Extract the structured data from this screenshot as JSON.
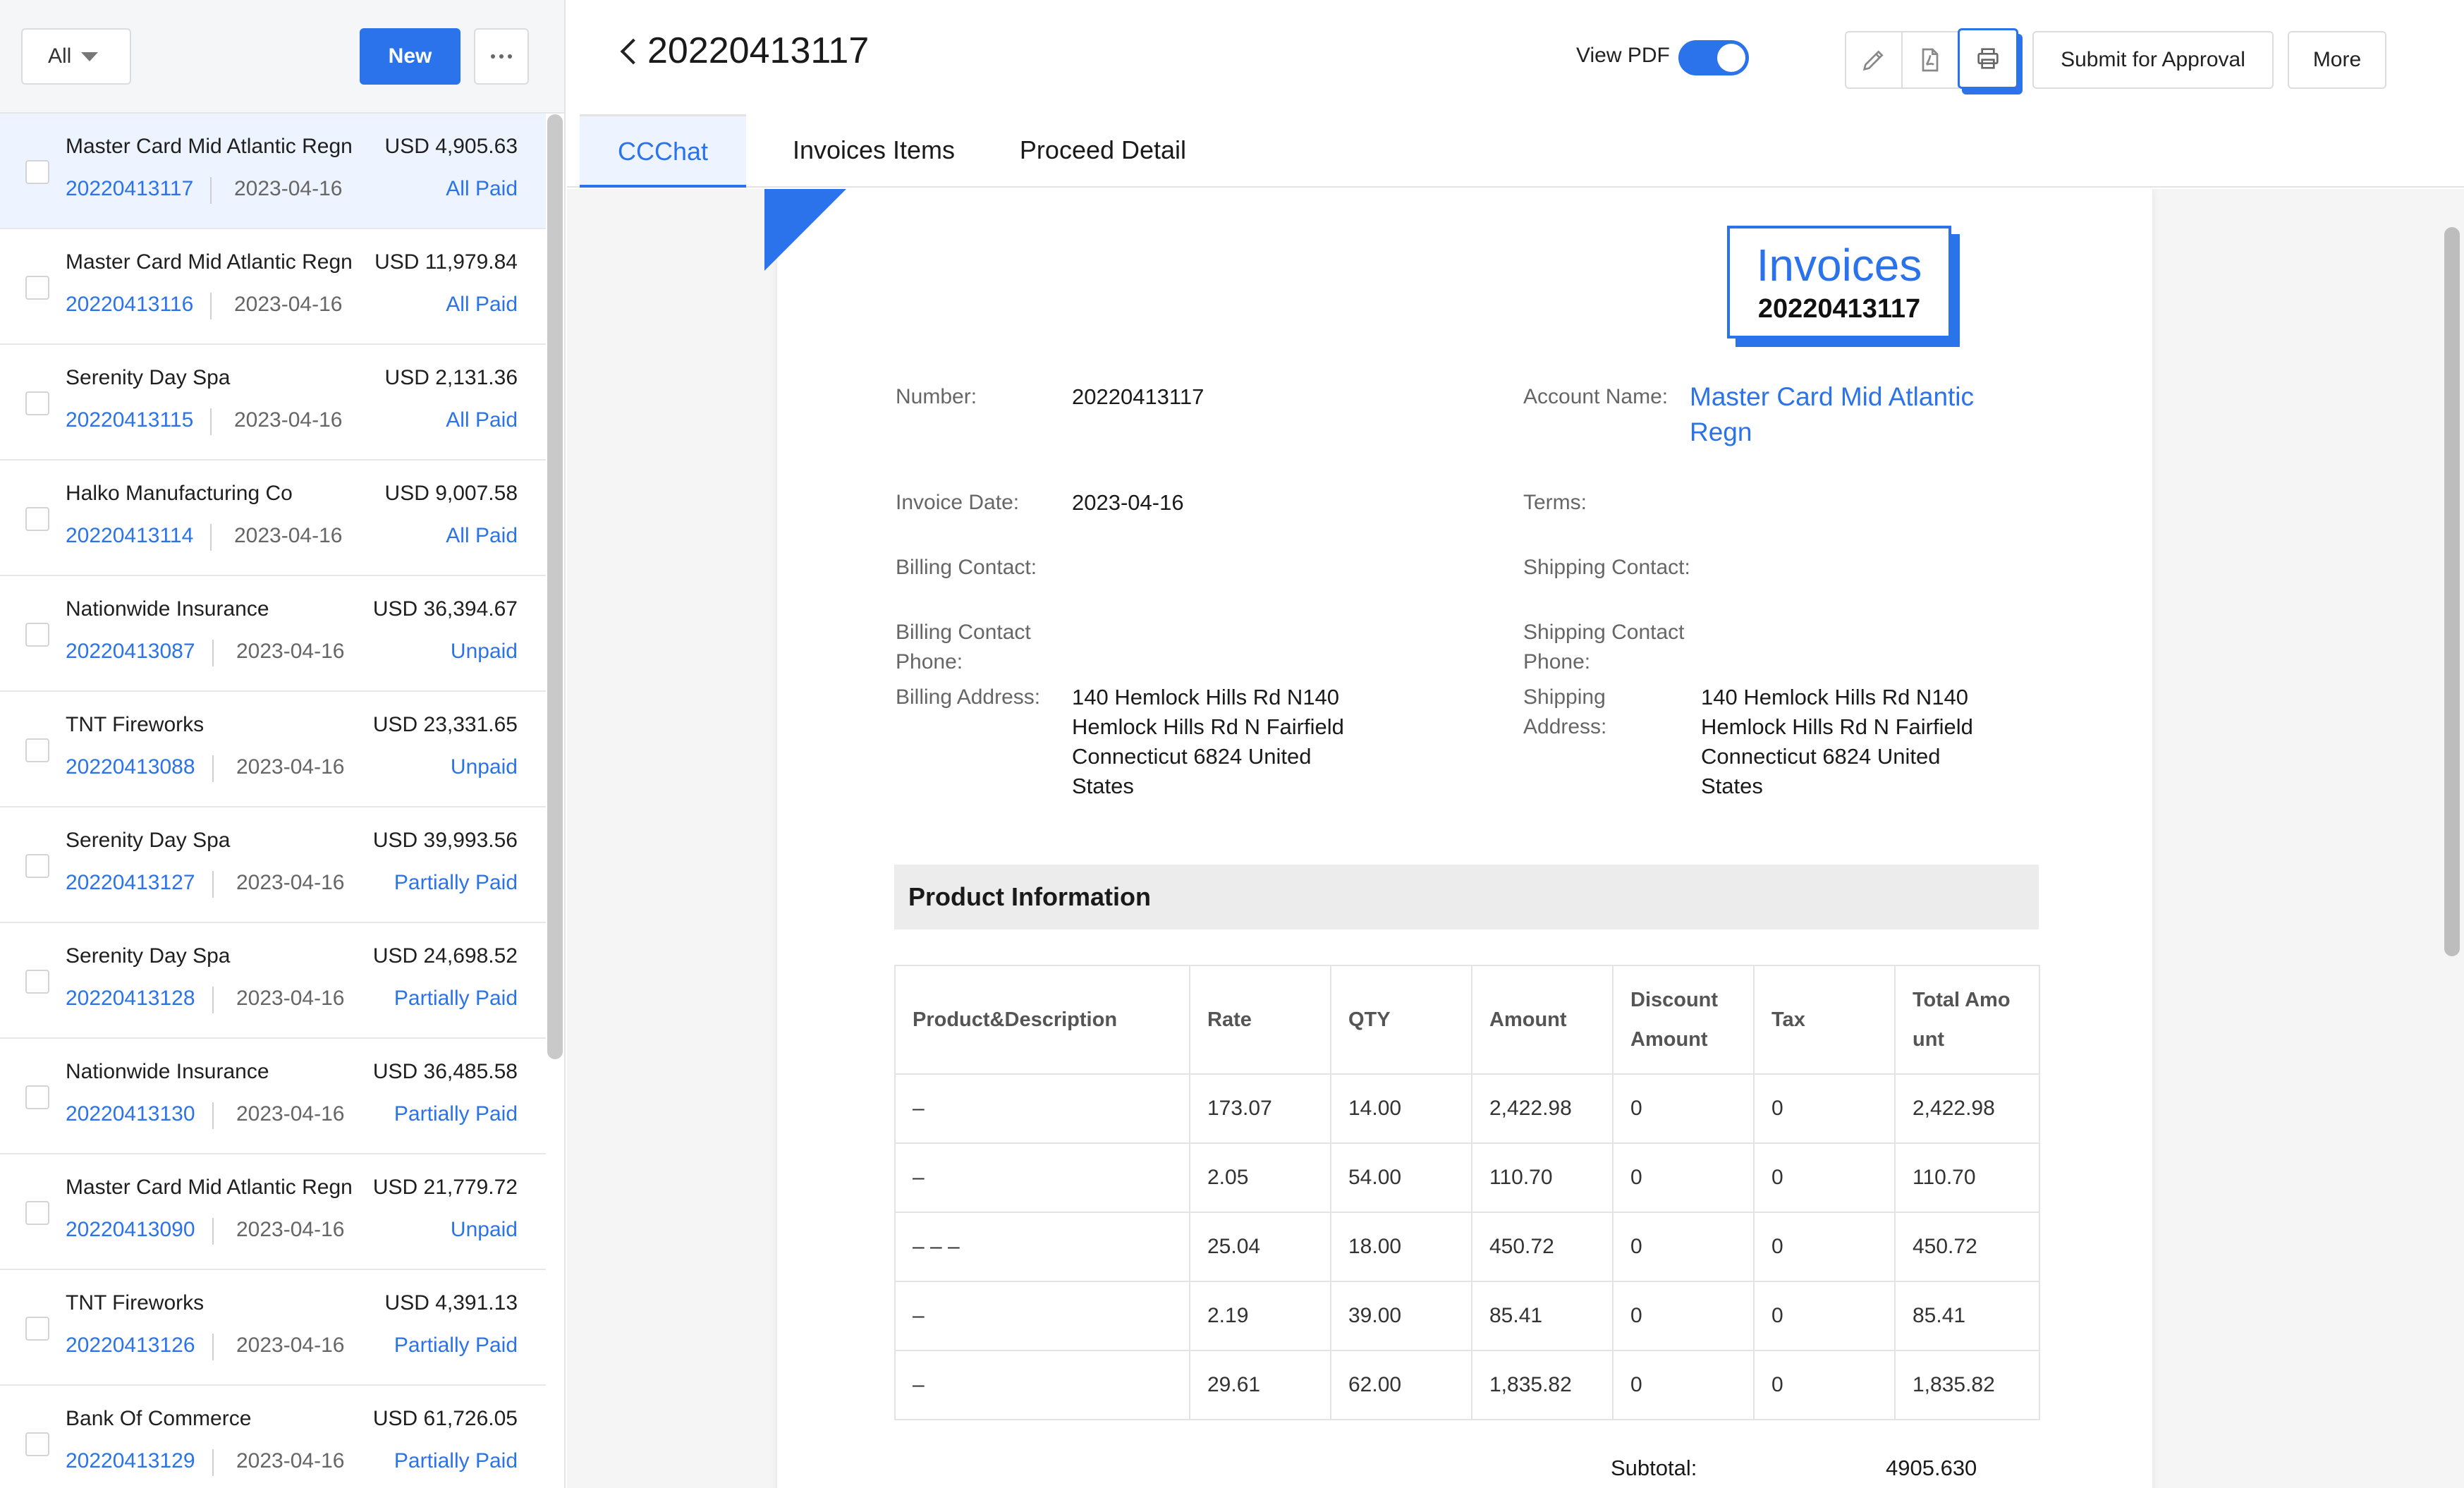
{
  "list_toolbar": {
    "filter_label": "All",
    "new_label": "New"
  },
  "invoices": [
    {
      "name": "Master Card Mid Atlantic Regn",
      "amount": "USD 4,905.63",
      "number": "20220413117",
      "date": "2023-04-16",
      "status": "All Paid"
    },
    {
      "name": "Master Card Mid Atlantic Regn",
      "amount": "USD 11,979.84",
      "number": "20220413116",
      "date": "2023-04-16",
      "status": "All Paid"
    },
    {
      "name": "Serenity Day Spa",
      "amount": "USD 2,131.36",
      "number": "20220413115",
      "date": "2023-04-16",
      "status": "All Paid"
    },
    {
      "name": "Halko Manufacturing Co",
      "amount": "USD 9,007.58",
      "number": "20220413114",
      "date": "2023-04-16",
      "status": "All Paid"
    },
    {
      "name": "Nationwide Insurance",
      "amount": "USD 36,394.67",
      "number": "20220413087",
      "date": "2023-04-16",
      "status": "Unpaid"
    },
    {
      "name": "TNT Fireworks",
      "amount": "USD 23,331.65",
      "number": "20220413088",
      "date": "2023-04-16",
      "status": "Unpaid"
    },
    {
      "name": "Serenity Day Spa",
      "amount": "USD 39,993.56",
      "number": "20220413127",
      "date": "2023-04-16",
      "status": "Partially Paid"
    },
    {
      "name": "Serenity Day Spa",
      "amount": "USD 24,698.52",
      "number": "20220413128",
      "date": "2023-04-16",
      "status": "Partially Paid"
    },
    {
      "name": "Nationwide Insurance",
      "amount": "USD 36,485.58",
      "number": "20220413130",
      "date": "2023-04-16",
      "status": "Partially Paid"
    },
    {
      "name": "Master Card Mid Atlantic Regn",
      "amount": "USD 21,779.72",
      "number": "20220413090",
      "date": "2023-04-16",
      "status": "Unpaid"
    },
    {
      "name": "TNT Fireworks",
      "amount": "USD 4,391.13",
      "number": "20220413126",
      "date": "2023-04-16",
      "status": "Partially Paid"
    },
    {
      "name": "Bank Of Commerce",
      "amount": "USD 61,726.05",
      "number": "20220413129",
      "date": "2023-04-16",
      "status": "Partially Paid"
    }
  ],
  "header": {
    "title": "20220413117",
    "view_pdf_label": "View PDF",
    "view_pdf_on": true,
    "submit_label": "Submit for Approval",
    "more_label": "More"
  },
  "tabs": [
    {
      "label": "CCChat",
      "active": true
    },
    {
      "label": "Invoices Items",
      "active": false
    },
    {
      "label": "Proceed Detail",
      "active": false
    }
  ],
  "invoice_doc": {
    "badge_title": "Invoices",
    "badge_number": "20220413117",
    "number_label": "Number:",
    "number_value": "20220413117",
    "account_label": "Account Name:",
    "account_value_line1": "Master Card Mid Atlantic",
    "account_value_line2": "Regn",
    "invoice_date_label": "Invoice Date:",
    "invoice_date_value": "2023-04-16",
    "terms_label": "Terms:",
    "billing_contact_label": "Billing Contact:",
    "shipping_contact_label": "Shipping Contact:",
    "billing_phone_label_line1": "Billing Contact",
    "billing_phone_label_line2": "Phone:",
    "shipping_phone_label_line1": "Shipping Contact",
    "shipping_phone_label_line2": "Phone:",
    "billing_address_label": "Billing Address:",
    "billing_address_lines": [
      "140 Hemlock Hills Rd N140",
      "Hemlock Hills Rd N Fairfield",
      "Connecticut 6824 United",
      "States"
    ],
    "shipping_address_label_line1": "Shipping",
    "shipping_address_label_line2": "Address:",
    "shipping_address_lines": [
      "140 Hemlock Hills Rd N140",
      "Hemlock Hills Rd N Fairfield",
      "Connecticut 6824 United",
      "States"
    ],
    "product_info_title": "Product Information",
    "table_headers": [
      "Product&Description",
      "Rate",
      "QTY",
      "Amount",
      "Discount Amount",
      "Tax",
      "Total Amount"
    ],
    "table_rows": [
      [
        "–",
        "173.07",
        "14.00",
        "2,422.98",
        "0",
        "0",
        "2,422.98"
      ],
      [
        "–",
        "2.05",
        "54.00",
        "110.70",
        "0",
        "0",
        "110.70"
      ],
      [
        "– – –",
        "25.04",
        "18.00",
        "450.72",
        "0",
        "0",
        "450.72"
      ],
      [
        "–",
        "2.19",
        "39.00",
        "85.41",
        "0",
        "0",
        "85.41"
      ],
      [
        "–",
        "29.61",
        "62.00",
        "1,835.82",
        "0",
        "0",
        "1,835.82"
      ]
    ],
    "subtotal_label": "Subtotal:",
    "subtotal_value": "4905.630"
  },
  "icons": {
    "edit": "pencil-icon",
    "pdf": "file-pdf-icon",
    "print": "printer-icon",
    "back": "chevron-left-icon",
    "filter": "caret-down-icon",
    "more": "ellipsis-icon"
  },
  "colors": {
    "accent": "#2b73ea",
    "selected_row": "#eef4ff"
  }
}
